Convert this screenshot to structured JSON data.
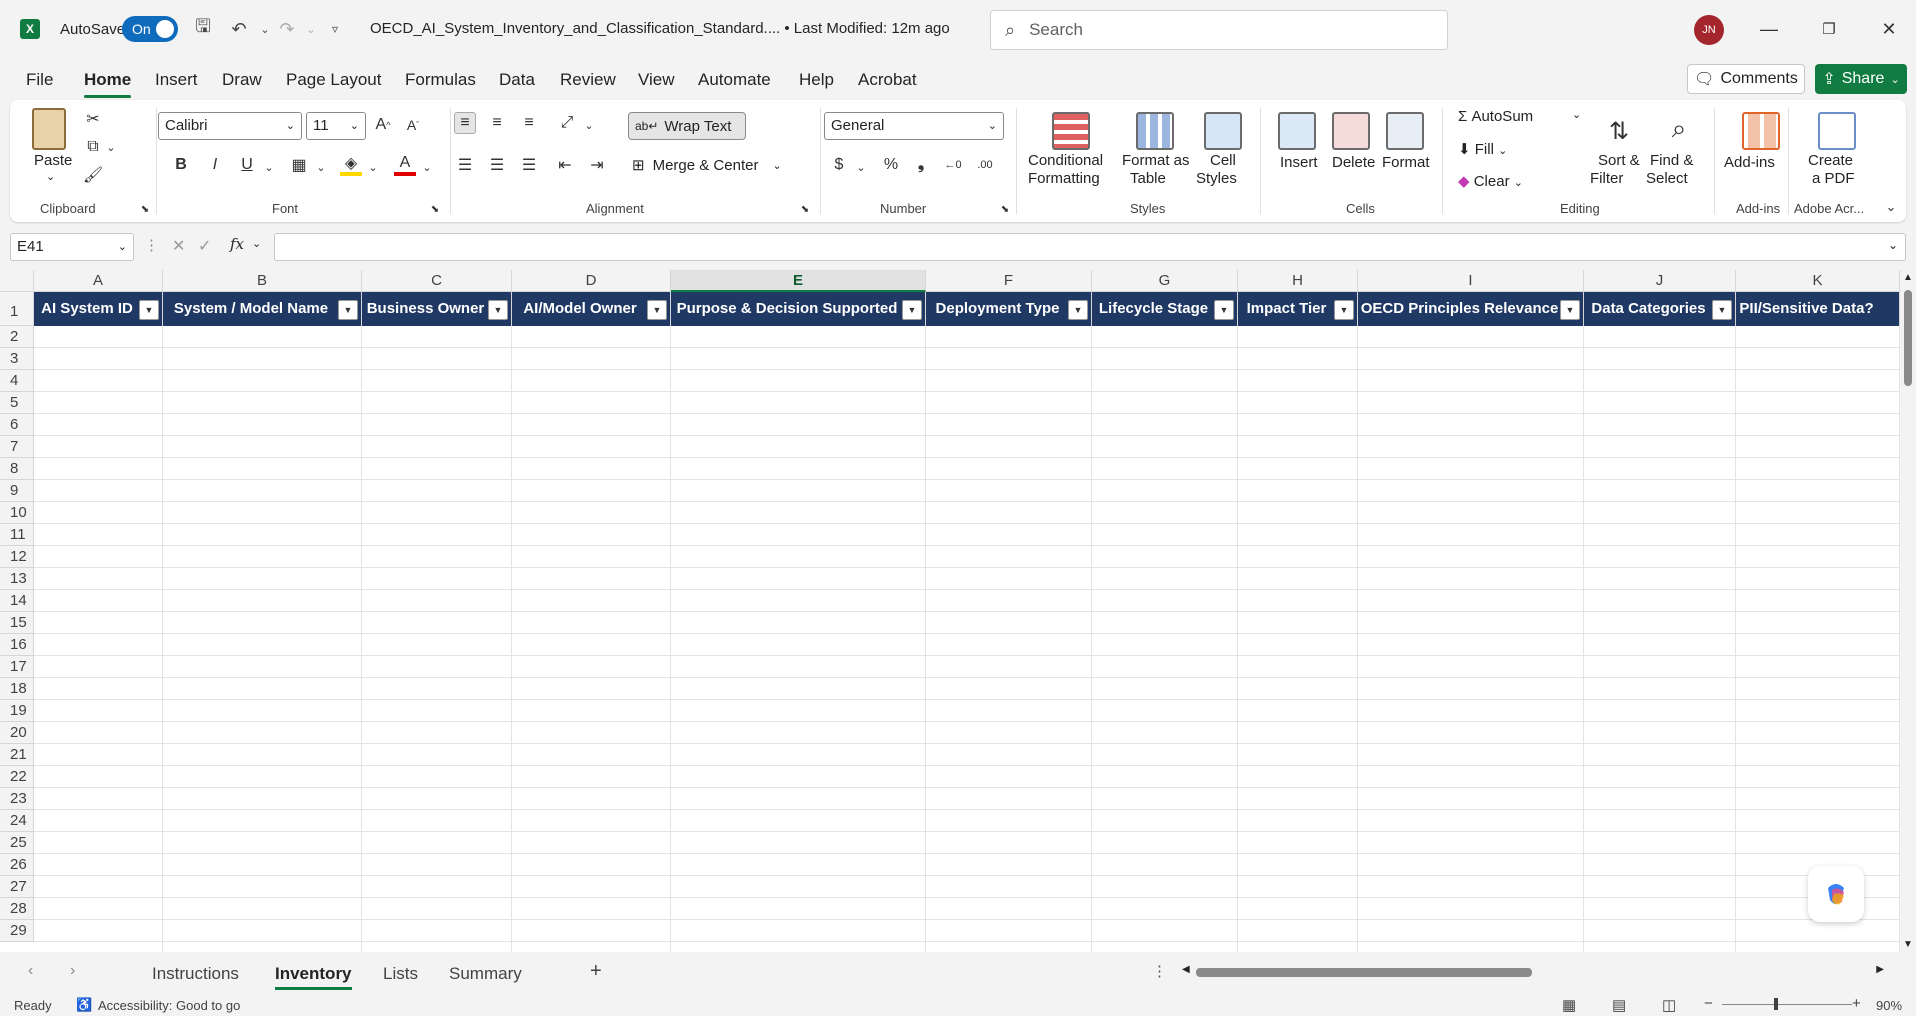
{
  "titlebar": {
    "autosave_label": "AutoSave",
    "autosave_state": "On",
    "doc_title": "OECD_AI_System_Inventory_and_Classification_Standard....  •  Last Modified: 12m ago",
    "search_placeholder": "Search",
    "avatar_initials": "JN"
  },
  "menu": {
    "tabs": [
      "File",
      "Home",
      "Insert",
      "Draw",
      "Page Layout",
      "Formulas",
      "Data",
      "Review",
      "View",
      "Automate",
      "Help",
      "Acrobat"
    ],
    "comments": "Comments",
    "share": "Share"
  },
  "ribbon": {
    "paste": "Paste",
    "font_name": "Calibri",
    "font_size": "11",
    "wrap_text": "Wrap Text",
    "merge_center": "Merge & Center",
    "number_format": "General",
    "conditional_formatting": [
      "Conditional",
      "Formatting"
    ],
    "format_as_table": [
      "Format as",
      "Table"
    ],
    "cell_styles": [
      "Cell",
      "Styles"
    ],
    "insert": "Insert",
    "delete": "Delete",
    "format": "Format",
    "autosum": "AutoSum",
    "fill": "Fill",
    "clear": "Clear",
    "sort_filter": [
      "Sort &",
      "Filter"
    ],
    "find_select": [
      "Find &",
      "Select"
    ],
    "addins": "Add-ins",
    "create_pdf": [
      "Create",
      "a PDF"
    ],
    "groups": {
      "clipboard": "Clipboard",
      "font": "Font",
      "alignment": "Alignment",
      "number": "Number",
      "styles": "Styles",
      "cells": "Cells",
      "editing": "Editing",
      "addins": "Add-ins",
      "adobe": "Adobe Acr..."
    }
  },
  "formula_bar": {
    "name_box": "E41",
    "fx": "fx",
    "value": ""
  },
  "sheet": {
    "columns": [
      "A",
      "B",
      "C",
      "D",
      "E",
      "F",
      "G",
      "H",
      "I",
      "J",
      "K"
    ],
    "selected_column": "E",
    "headers": [
      "AI System ID",
      "System / Model Name",
      "Business Owner",
      "AI/Model Owner",
      "Purpose & Decision Supported",
      "Deployment Type",
      "Lifecycle Stage",
      "Impact Tier",
      "OECD Principles Relevance",
      "Data Categories",
      "PII/Sensitive Data?"
    ],
    "rows": [
      "1",
      "2",
      "3",
      "4",
      "5",
      "6",
      "7",
      "8",
      "9",
      "10",
      "11",
      "12",
      "13",
      "14",
      "15",
      "16",
      "17",
      "18",
      "19",
      "20",
      "21",
      "22",
      "23",
      "24",
      "25",
      "26",
      "27",
      "28",
      "29"
    ]
  },
  "sheet_tabs": {
    "tabs": [
      "Instructions",
      "Inventory",
      "Lists",
      "Summary"
    ],
    "active": "Inventory",
    "add": "+"
  },
  "status": {
    "ready": "Ready",
    "accessibility": "Accessibility: Good to go",
    "zoom": "90%"
  },
  "colors": {
    "header_fill": "#1f3864",
    "accent": "#107c41"
  }
}
